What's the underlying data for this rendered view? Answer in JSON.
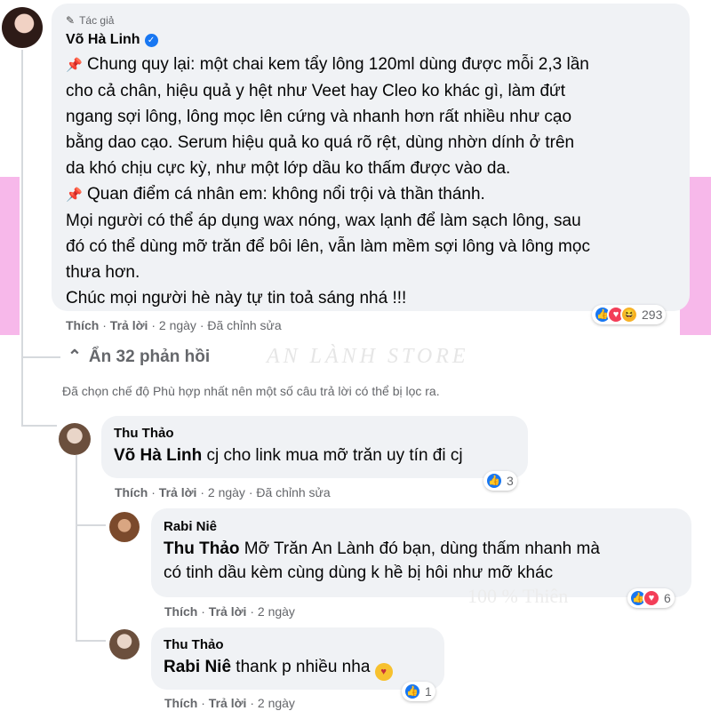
{
  "main_comment": {
    "author_tag": "Tác giả",
    "author_name": "Võ Hà Linh",
    "lines": [
      "Chung quy lại: một chai kem tẩy lông 120ml dùng được mỗi 2,3 lần",
      "cho cả chân, hiệu quả y hệt như Veet hay Cleo ko khác gì, làm đứt",
      "ngang sợi lông, lông mọc lên cứng và nhanh hơn rất nhiều như cạo",
      "bằng dao cạo. Serum hiệu quả ko quá rõ rệt, dùng nhờn dính ở trên",
      "da khó chịu cực kỳ, như một lớp dầu ko thấm được vào da.",
      "Quan điểm cá nhân em: không nổi trội và thần thánh.",
      "Mọi người có thể áp dụng wax nóng, wax lạnh để làm sạch lông, sau",
      "đó có thể dùng mỡ trăn để bôi lên, vẫn làm mềm sợi lông và lông mọc",
      "thưa hơn.",
      "Chúc mọi người hè này tự tin toả sáng nhá !!!"
    ],
    "like_label": "Thích",
    "reply_label": "Trả lời",
    "time": "2 ngày",
    "edited": "Đã chỉnh sửa",
    "reaction_count": "293"
  },
  "hide_replies": "Ẩn 32 phản hồi",
  "watermark": "AN LÀNH STORE",
  "watermark2": "100 % Thiên",
  "filter_note": "Đã chọn chế độ Phù hợp nhất nên một số câu trả lời có thể bị lọc ra.",
  "replies": [
    {
      "name": "Thu Thảo",
      "mention": "Võ Hà Linh",
      "text": " cj cho link mua mỡ trăn uy tín đi cj",
      "like_label": "Thích",
      "reply_label": "Trả lời",
      "time": "2 ngày",
      "edited": "Đã chỉnh sửa",
      "reaction_count": "3"
    },
    {
      "name": "Rabi Niê",
      "mention": "Thu Thảo",
      "text_line1": " Mỡ Trăn An Lành đó bạn, dùng thấm nhanh mà",
      "text_line2": "có tinh dầu kèm cùng dùng k hề bị hôi như mỡ khác",
      "like_label": "Thích",
      "reply_label": "Trả lời",
      "time": "2 ngày",
      "reaction_count": "6"
    },
    {
      "name": "Thu Thảo",
      "mention": "Rabi Niê",
      "text": " thank p nhiều nha",
      "like_label": "Thích",
      "reply_label": "Trả lời",
      "time": "2 ngày",
      "reaction_count": "1"
    }
  ],
  "icons": {
    "pin": "pushpin-icon",
    "verified": "verified-badge-icon",
    "like": "like-reaction-icon",
    "love": "love-reaction-icon",
    "haha": "haha-reaction-icon",
    "chevron": "chevron-up-icon",
    "pen": "pen-icon",
    "kiss": "kiss-emoji-icon"
  },
  "colors": {
    "bubble": "#f0f2f5",
    "meta_text": "#65676b",
    "like_blue": "#1877f2",
    "love_red": "#f33e58",
    "pink_overlay": "#f7b8ea"
  }
}
